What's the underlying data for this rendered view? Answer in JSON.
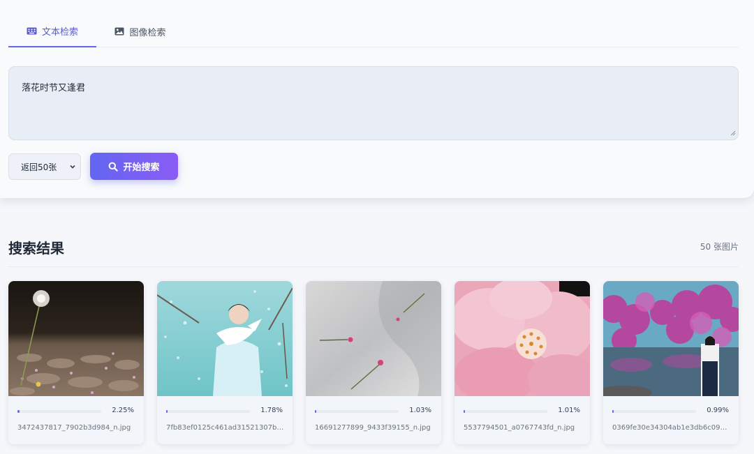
{
  "tabs": [
    {
      "label": "文本检索",
      "icon": "keyboard-icon",
      "active": true
    },
    {
      "label": "图像检索",
      "icon": "image-icon",
      "active": false
    }
  ],
  "query": {
    "value": "落花时节又逢君"
  },
  "count_select": {
    "selected": "返回50张"
  },
  "search_button": {
    "label": "开始搜索",
    "icon": "search-icon"
  },
  "results": {
    "title": "搜索结果",
    "count": "50 张图片",
    "items": [
      {
        "score": "2.25%",
        "score_value": 0.0225,
        "filename": "3472437817_7902b3d984_n.jpg"
      },
      {
        "score": "1.78%",
        "score_value": 0.0178,
        "filename": "7fb83ef0125c461ad31521307bb..."
      },
      {
        "score": "1.03%",
        "score_value": 0.0103,
        "filename": "16691277899_9433f39155_n.jpg"
      },
      {
        "score": "1.01%",
        "score_value": 0.0101,
        "filename": "5537794501_a0767743fd_n.jpg"
      },
      {
        "score": "0.99%",
        "score_value": 0.0099,
        "filename": "0369fe30e34304ab1e3db6c091..."
      }
    ]
  },
  "colors": {
    "accent": "#6366f1",
    "accent_end": "#8b5cf6"
  }
}
